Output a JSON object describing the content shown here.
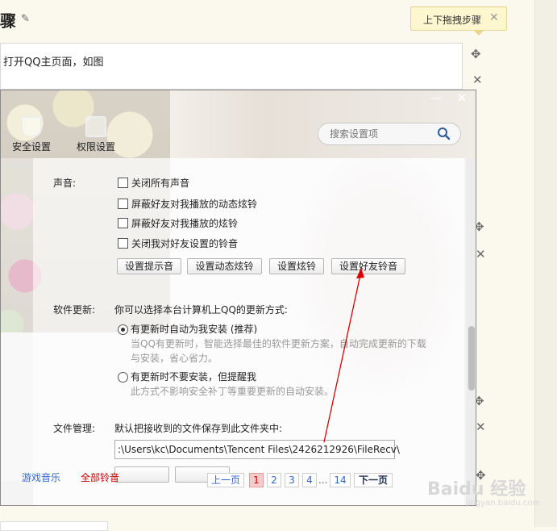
{
  "editor": {
    "title_char": "骤",
    "step_text": "打开QQ主页面，如图",
    "tooltip": "上下拖拽步骤",
    "tooltip_close": "✕"
  },
  "dialog": {
    "tabs": [
      {
        "label": "安全设置",
        "icon": "shield-icon"
      },
      {
        "label": "权限设置",
        "icon": "lock-icon"
      }
    ],
    "search_placeholder": "搜索设置项",
    "sound": {
      "label": "声音:",
      "options": [
        "关闭所有声音",
        "屏蔽好友对我播放的动态炫铃",
        "屏蔽好友对我播放的炫铃",
        "关闭我对好友设置的铃音"
      ],
      "buttons": [
        "设置提示音",
        "设置动态炫铃",
        "设置炫铃",
        "设置好友铃音"
      ]
    },
    "update": {
      "label": "软件更新:",
      "intro": "你可以选择本台计算机上QQ的更新方式:",
      "opt1": "有更新时自动为我安装 (推荐)",
      "opt1_desc1": "当QQ有更新时，智能选择最佳的软件更新方案，自动完成更新的下载",
      "opt1_desc2": "与安装，省心省力。",
      "opt2": "有更新时不要安装，但提醒我",
      "opt2_desc": "此方式不影响安全补丁等重要更新的自动安装。"
    },
    "files": {
      "label": "文件管理:",
      "intro": "默认把接收到的文件保存到此文件夹中:",
      "path": ":\\Users\\kc\\Documents\\Tencent Files\\2426212926\\FileRecv\\"
    }
  },
  "music_links": [
    "游戏音乐",
    "全部铃音"
  ],
  "pagination": {
    "prev": "上一页",
    "pages": [
      "1",
      "2",
      "3",
      "4",
      "...",
      "14"
    ],
    "current": "1",
    "next": "下一页"
  },
  "watermark": {
    "text": "Baidu 经验",
    "sub": "jingyan.baidu.com"
  }
}
